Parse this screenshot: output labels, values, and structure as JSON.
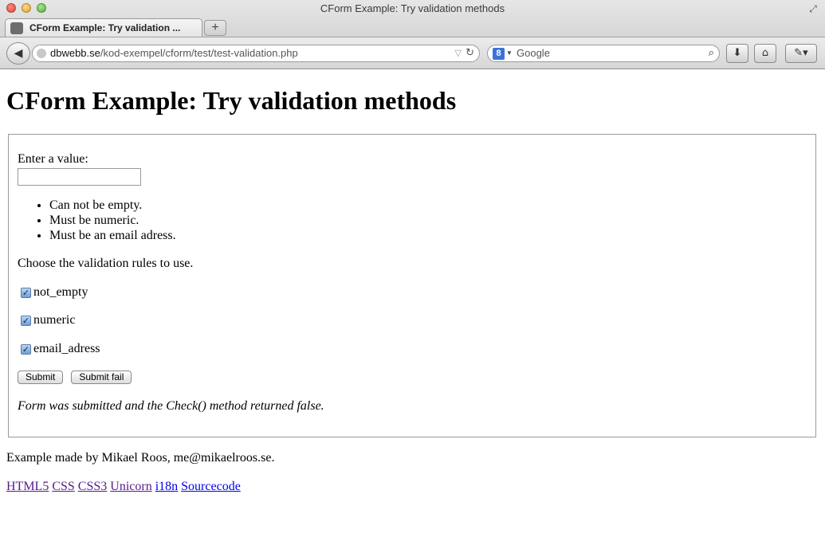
{
  "window": {
    "title": "CForm Example: Try validation methods"
  },
  "tabs": [
    {
      "label": "CForm Example: Try validation ..."
    }
  ],
  "newtab_label": "+",
  "url": {
    "host": "dbwebb.se",
    "path": "/kod-exempel/cform/test/test-validation.php"
  },
  "search": {
    "placeholder": "Google",
    "engine_glyph": "8"
  },
  "icons": {
    "back": "back-arrow-icon",
    "globe": "globe-icon",
    "bookmark": "bookmark-star-icon",
    "reload": "reload-icon",
    "search": "magnifier-icon",
    "download": "download-arrow-icon",
    "home": "home-icon",
    "tools": "eyedropper-icon"
  },
  "page": {
    "heading": "CForm Example: Try validation methods",
    "form": {
      "input_label": "Enter a value:",
      "input_value": "",
      "rules": [
        "Can not be empty.",
        "Must be numeric.",
        "Must be an email adress."
      ],
      "choose_text": "Choose the validation rules to use.",
      "checkboxes": [
        {
          "label": "not_empty",
          "checked": true
        },
        {
          "label": "numeric",
          "checked": true
        },
        {
          "label": "email_adress",
          "checked": true
        }
      ],
      "submit_label": "Submit",
      "submit_fail_label": "Submit fail",
      "result_text": "Form was submitted and the Check() method returned false."
    },
    "footer_text": "Example made by Mikael Roos, me@mikaelroos.se.",
    "links": [
      "HTML5",
      "CSS",
      "CSS3",
      "Unicorn",
      "i18n",
      "Sourcecode"
    ]
  }
}
